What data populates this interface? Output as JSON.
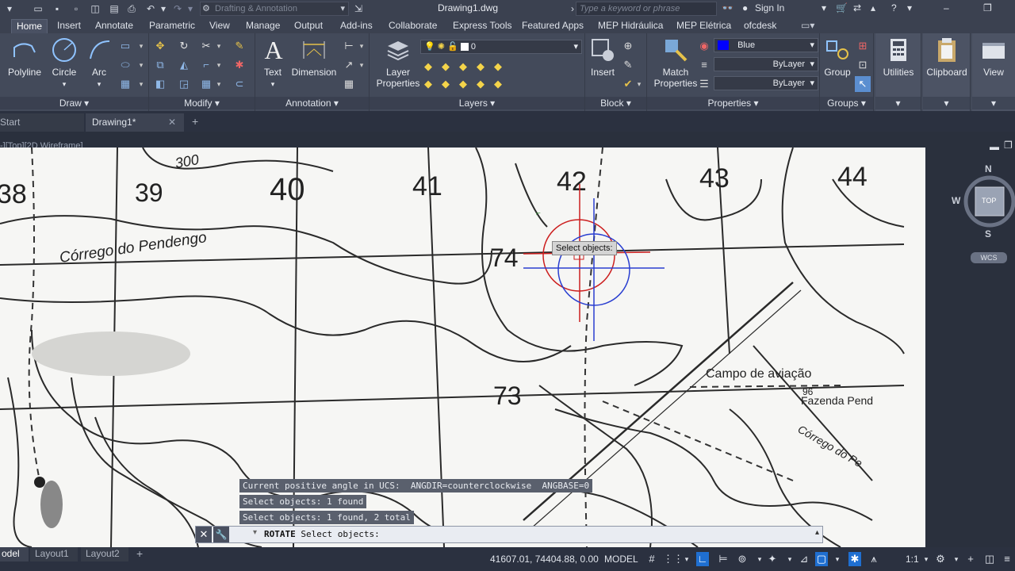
{
  "app": {
    "doc_title": "Drawing1.dwg",
    "workspace": "Drafting & Annotation",
    "search_placeholder": "Type a keyword or phrase",
    "sign_in": "Sign In"
  },
  "ribbon_tabs": [
    "Home",
    "Insert",
    "Annotate",
    "Parametric",
    "View",
    "Manage",
    "Output",
    "Add-ins",
    "Collaborate",
    "Express Tools",
    "Featured Apps",
    "MEP Hidráulica",
    "MEP Elétrica",
    "ofcdesk"
  ],
  "panels": {
    "draw": {
      "label": "Draw",
      "polyline": "Polyline",
      "circle": "Circle",
      "arc": "Arc"
    },
    "modify": {
      "label": "Modify"
    },
    "annotation": {
      "label": "Annotation",
      "text": "Text",
      "dimension": "Dimension"
    },
    "layers": {
      "label": "Layers",
      "layer_properties_l1": "Layer",
      "layer_properties_l2": "Properties",
      "current_layer": "0"
    },
    "block": {
      "label": "Block",
      "insert": "Insert"
    },
    "properties": {
      "label": "Properties",
      "match_l1": "Match",
      "match_l2": "Properties",
      "color": "Blue",
      "linetype": "ByLayer",
      "lineweight": "ByLayer"
    },
    "groups": {
      "label": "Groups",
      "group": "Group"
    },
    "utilities": {
      "label": "Utilities"
    },
    "clipboard": {
      "label": "Clipboard"
    },
    "view": {
      "label": "View"
    }
  },
  "file_tabs": {
    "start": "Start",
    "drawing": "Drawing1*"
  },
  "viewport": {
    "label": "-][Top][2D Wireframe]"
  },
  "map_labels": {
    "grid_numbers": [
      "38",
      "39",
      "40",
      "41",
      "42",
      "43",
      "44"
    ],
    "elev_300": "300",
    "pt74": "74",
    "pt73": "73",
    "corrego_pendengo": "Córrego do Pendengo",
    "campo": "Campo de aviação",
    "fazenda": "Fazenda Pend",
    "corrego_pe": "Córrego do Pe",
    "n96": "96"
  },
  "cursor_tooltip": "Select objects:",
  "command_history": [
    "Current positive angle in UCS:  ANGDIR=counterclockwise  ANGBASE=0",
    "Select objects: 1 found",
    "Select objects: 1 found, 2 total"
  ],
  "command_line": {
    "command": "ROTATE",
    "prompt": "Select objects:"
  },
  "viewcube": {
    "n": "N",
    "s": "S",
    "w": "W",
    "top": "TOP",
    "wcs": "WCS"
  },
  "layout_tabs": [
    "odel",
    "Layout1",
    "Layout2"
  ],
  "status": {
    "coords": "41607.01, 74404.88, 0.00",
    "space": "MODEL",
    "scale": "1:1"
  },
  "colors": {
    "accent": "#1f6fd1",
    "bg": "#2b3140",
    "ribbon": "#434a5a",
    "blue_swatch": "#0000ff",
    "crosshair_red": "#cc1f1f",
    "crosshair_blue": "#2a3fd0"
  }
}
